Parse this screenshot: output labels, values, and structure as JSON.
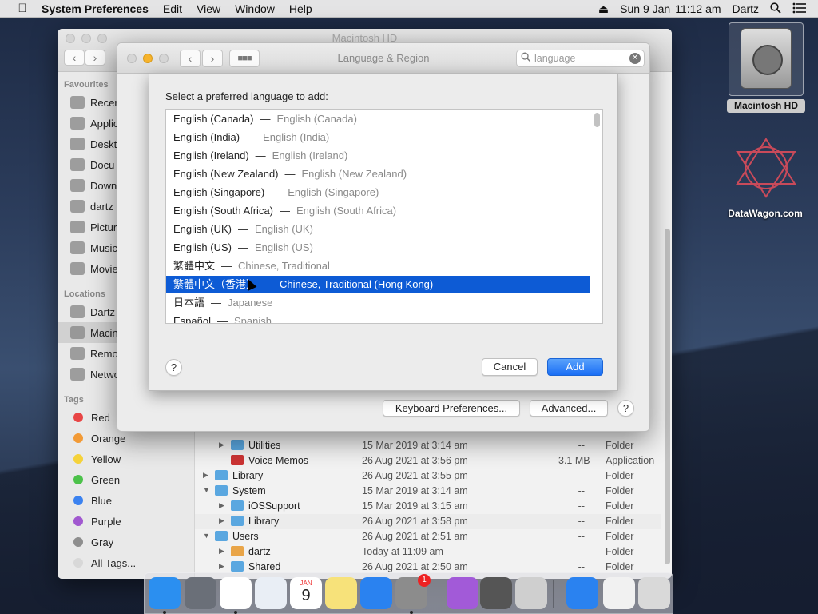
{
  "menubar": {
    "app_name": "System Preferences",
    "items": [
      "Edit",
      "View",
      "Window",
      "Help"
    ],
    "date": "Sun 9 Jan",
    "time": "11:12 am",
    "user": "Dartz"
  },
  "desktop": {
    "hd_label": "Macintosh HD",
    "datawagon_label": "DataWagon.com"
  },
  "finder": {
    "title": "Macintosh HD",
    "favourites_header": "Favourites",
    "favourites": [
      "Recer",
      "Applic",
      "Deskt",
      "Docu",
      "Down",
      "dartz",
      "Pictur",
      "Music",
      "Movie"
    ],
    "locations_header": "Locations",
    "locations": [
      "Dartz",
      "Macin",
      "Remo",
      "Netwo"
    ],
    "tags_header": "Tags",
    "tags": [
      {
        "label": "Red",
        "color": "#e84545"
      },
      {
        "label": "Orange",
        "color": "#f29a36"
      },
      {
        "label": "Yellow",
        "color": "#f5d23a"
      },
      {
        "label": "Green",
        "color": "#4cc24a"
      },
      {
        "label": "Blue",
        "color": "#3b82f0"
      },
      {
        "label": "Purple",
        "color": "#a158d0"
      },
      {
        "label": "Gray",
        "color": "#8e8e8e"
      },
      {
        "label": "All Tags...",
        "color": "#d8d8d8"
      }
    ],
    "rows": [
      {
        "name": "Utilities",
        "date": "15 Mar 2019 at 3:14 am",
        "size": "--",
        "kind": "Folder"
      },
      {
        "name": "Voice Memos",
        "date": "26 Aug 2021 at 3:56 pm",
        "size": "3.1 MB",
        "kind": "Application"
      },
      {
        "name": "Library",
        "date": "26 Aug 2021 at 3:55 pm",
        "size": "--",
        "kind": "Folder"
      },
      {
        "name": "System",
        "date": "15 Mar 2019 at 3:14 am",
        "size": "--",
        "kind": "Folder"
      },
      {
        "name": "iOSSupport",
        "date": "15 Mar 2019 at 3:15 am",
        "size": "--",
        "kind": "Folder"
      },
      {
        "name": "Library",
        "date": "26 Aug 2021 at 3:58 pm",
        "size": "--",
        "kind": "Folder"
      },
      {
        "name": "Users",
        "date": "26 Aug 2021 at 2:51 am",
        "size": "--",
        "kind": "Folder"
      },
      {
        "name": "dartz",
        "date": "Today at 11:09 am",
        "size": "--",
        "kind": "Folder"
      },
      {
        "name": "Shared",
        "date": "26 Aug 2021 at 2:50 am",
        "size": "--",
        "kind": "Folder"
      }
    ]
  },
  "prefs": {
    "title": "Language & Region",
    "search_value": "language",
    "keyboard_button": "Keyboard Preferences...",
    "advanced_button": "Advanced...",
    "help": "?"
  },
  "sheet": {
    "prompt": "Select a preferred language to add:",
    "languages": [
      {
        "native": "English (Canada)",
        "translated": "English (Canada)"
      },
      {
        "native": "English (India)",
        "translated": "English (India)"
      },
      {
        "native": "English (Ireland)",
        "translated": "English (Ireland)"
      },
      {
        "native": "English (New Zealand)",
        "translated": "English (New Zealand)"
      },
      {
        "native": "English (Singapore)",
        "translated": "English (Singapore)"
      },
      {
        "native": "English (South Africa)",
        "translated": "English (South Africa)"
      },
      {
        "native": "English (UK)",
        "translated": "English (UK)"
      },
      {
        "native": "English (US)",
        "translated": "English (US)"
      },
      {
        "native": "繁體中文",
        "translated": "Chinese, Traditional"
      },
      {
        "native": "繁體中文（香港）",
        "translated": "Chinese, Traditional (Hong Kong)"
      },
      {
        "native": "日本語",
        "translated": "Japanese"
      },
      {
        "native": "Español",
        "translated": "Spanish"
      }
    ],
    "selected_index": 9,
    "dash": "—",
    "help": "?",
    "cancel_label": "Cancel",
    "add_label": "Add"
  },
  "dock": {
    "items": [
      "finder-icon",
      "launchpad-icon",
      "chrome-icon",
      "safari-icon",
      "calendar-icon",
      "notes-icon",
      "app-store-icon",
      "system-preferences-icon",
      "siri-icon",
      "calculator-icon",
      "automator-icon",
      "app-store-folder-icon",
      "document-icon",
      "trash-icon"
    ],
    "calendar_month": "JAN",
    "calendar_day": "9",
    "prefs_badge": "1"
  }
}
